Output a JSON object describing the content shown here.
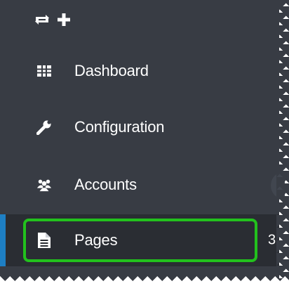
{
  "toolbar": {
    "icons": [
      "swap-icon",
      "plus-icon"
    ]
  },
  "sidebar": {
    "items": [
      {
        "label": "Dashboard",
        "icon": "grid-icon"
      },
      {
        "label": "Configuration",
        "icon": "wrench-icon"
      },
      {
        "label": "Accounts",
        "icon": "users-icon"
      },
      {
        "label": "Pages",
        "icon": "document-icon",
        "count": "3",
        "active": true
      }
    ]
  },
  "colors": {
    "sidebar_bg": "#383c44",
    "active_bg": "#2a2d33",
    "active_bar": "#1e7fc4",
    "highlight": "#22c11d",
    "text": "#ffffff"
  }
}
